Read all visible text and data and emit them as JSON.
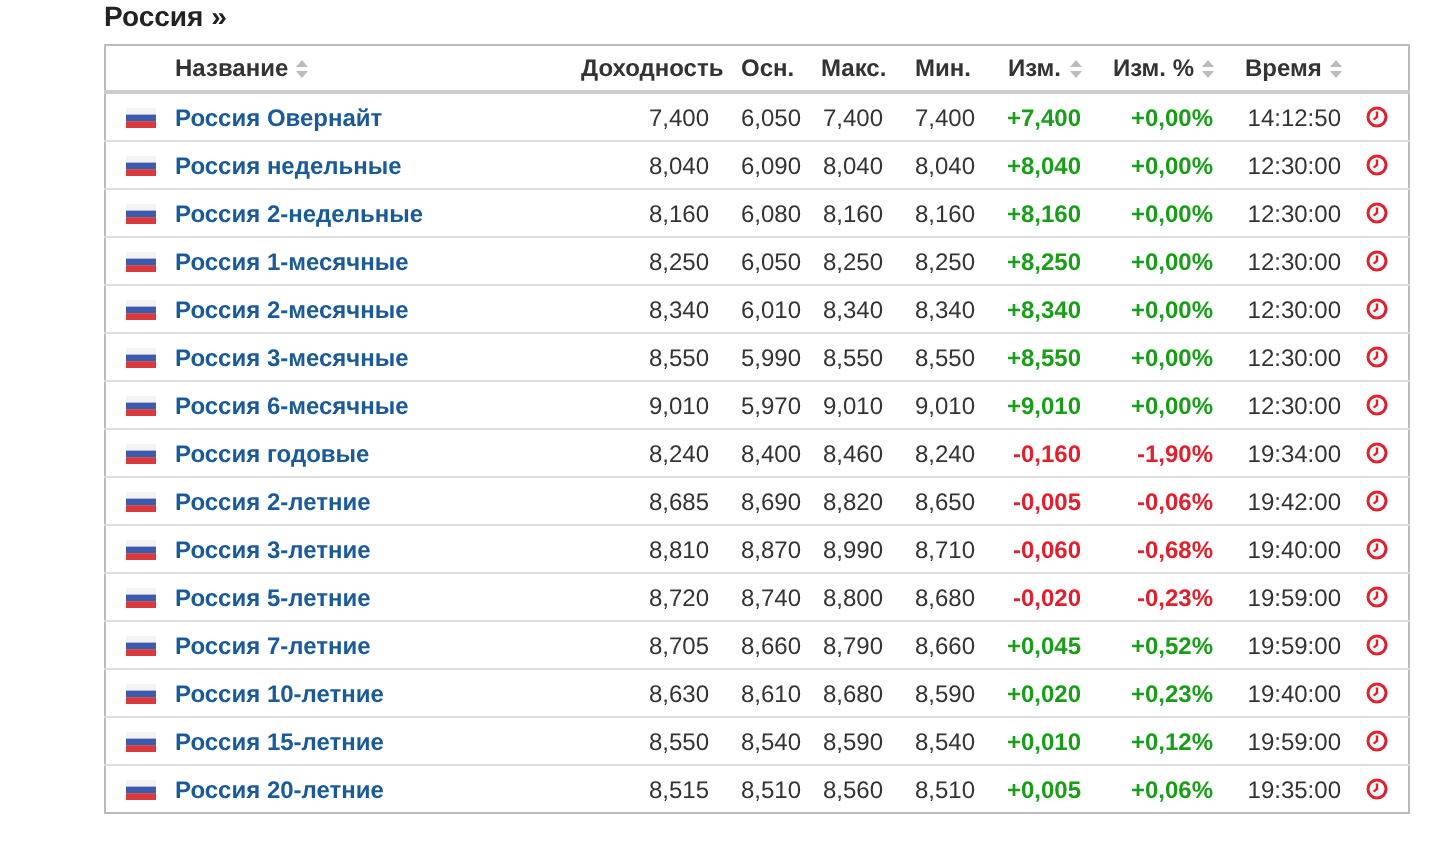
{
  "heading": "Россия »",
  "columns": [
    {
      "label": "Название",
      "sortable": true
    },
    {
      "label": "Доходность",
      "sortable": false
    },
    {
      "label": "Осн.",
      "sortable": false
    },
    {
      "label": "Макс.",
      "sortable": false
    },
    {
      "label": "Мин.",
      "sortable": false
    },
    {
      "label": "Изм.",
      "sortable": true
    },
    {
      "label": "Изм. %",
      "sortable": true
    },
    {
      "label": "Время",
      "sortable": true
    }
  ],
  "rows": [
    {
      "name": "Россия Овернайт",
      "yield": "7,400",
      "prev": "6,050",
      "high": "7,400",
      "low": "7,400",
      "change": "+7,400",
      "change_pct": "+0,00%",
      "time": "14:12:50",
      "color": "#1a9e1a"
    },
    {
      "name": "Россия недельные",
      "yield": "8,040",
      "prev": "6,090",
      "high": "8,040",
      "low": "8,040",
      "change": "+8,040",
      "change_pct": "+0,00%",
      "time": "12:30:00",
      "color": "#1a9e1a"
    },
    {
      "name": "Россия 2-недельные",
      "yield": "8,160",
      "prev": "6,080",
      "high": "8,160",
      "low": "8,160",
      "change": "+8,160",
      "change_pct": "+0,00%",
      "time": "12:30:00",
      "color": "#1a9e1a"
    },
    {
      "name": "Россия 1-месячные",
      "yield": "8,250",
      "prev": "6,050",
      "high": "8,250",
      "low": "8,250",
      "change": "+8,250",
      "change_pct": "+0,00%",
      "time": "12:30:00",
      "color": "#1a9e1a"
    },
    {
      "name": "Россия 2-месячные",
      "yield": "8,340",
      "prev": "6,010",
      "high": "8,340",
      "low": "8,340",
      "change": "+8,340",
      "change_pct": "+0,00%",
      "time": "12:30:00",
      "color": "#1a9e1a"
    },
    {
      "name": "Россия 3-месячные",
      "yield": "8,550",
      "prev": "5,990",
      "high": "8,550",
      "low": "8,550",
      "change": "+8,550",
      "change_pct": "+0,00%",
      "time": "12:30:00",
      "color": "#1a9e1a"
    },
    {
      "name": "Россия 6-месячные",
      "yield": "9,010",
      "prev": "5,970",
      "high": "9,010",
      "low": "9,010",
      "change": "+9,010",
      "change_pct": "+0,00%",
      "time": "12:30:00",
      "color": "#1a9e1a"
    },
    {
      "name": "Россия годовые",
      "yield": "8,240",
      "prev": "8,400",
      "high": "8,460",
      "low": "8,240",
      "change": "-0,160",
      "change_pct": "-1,90%",
      "time": "19:34:00",
      "color": "#e0202c"
    },
    {
      "name": "Россия 2-летние",
      "yield": "8,685",
      "prev": "8,690",
      "high": "8,820",
      "low": "8,650",
      "change": "-0,005",
      "change_pct": "-0,06%",
      "time": "19:42:00",
      "color": "#e0202c"
    },
    {
      "name": "Россия 3-летние",
      "yield": "8,810",
      "prev": "8,870",
      "high": "8,990",
      "low": "8,710",
      "change": "-0,060",
      "change_pct": "-0,68%",
      "time": "19:40:00",
      "color": "#e0202c"
    },
    {
      "name": "Россия 5-летние",
      "yield": "8,720",
      "prev": "8,740",
      "high": "8,800",
      "low": "8,680",
      "change": "-0,020",
      "change_pct": "-0,23%",
      "time": "19:59:00",
      "color": "#e0202c"
    },
    {
      "name": "Россия 7-летние",
      "yield": "8,705",
      "prev": "8,660",
      "high": "8,790",
      "low": "8,660",
      "change": "+0,045",
      "change_pct": "+0,52%",
      "time": "19:59:00",
      "color": "#1a9e1a"
    },
    {
      "name": "Россия 10-летние",
      "yield": "8,630",
      "prev": "8,610",
      "high": "8,680",
      "low": "8,590",
      "change": "+0,020",
      "change_pct": "+0,23%",
      "time": "19:40:00",
      "color": "#1a9e1a"
    },
    {
      "name": "Россия 15-летние",
      "yield": "8,550",
      "prev": "8,540",
      "high": "8,590",
      "low": "8,540",
      "change": "+0,010",
      "change_pct": "+0,12%",
      "time": "19:59:00",
      "color": "#1a9e1a"
    },
    {
      "name": "Россия 20-летние",
      "yield": "8,515",
      "prev": "8,510",
      "high": "8,560",
      "low": "8,510",
      "change": "+0,005",
      "change_pct": "+0,06%",
      "time": "19:35:00",
      "color": "#1a9e1a"
    }
  ]
}
